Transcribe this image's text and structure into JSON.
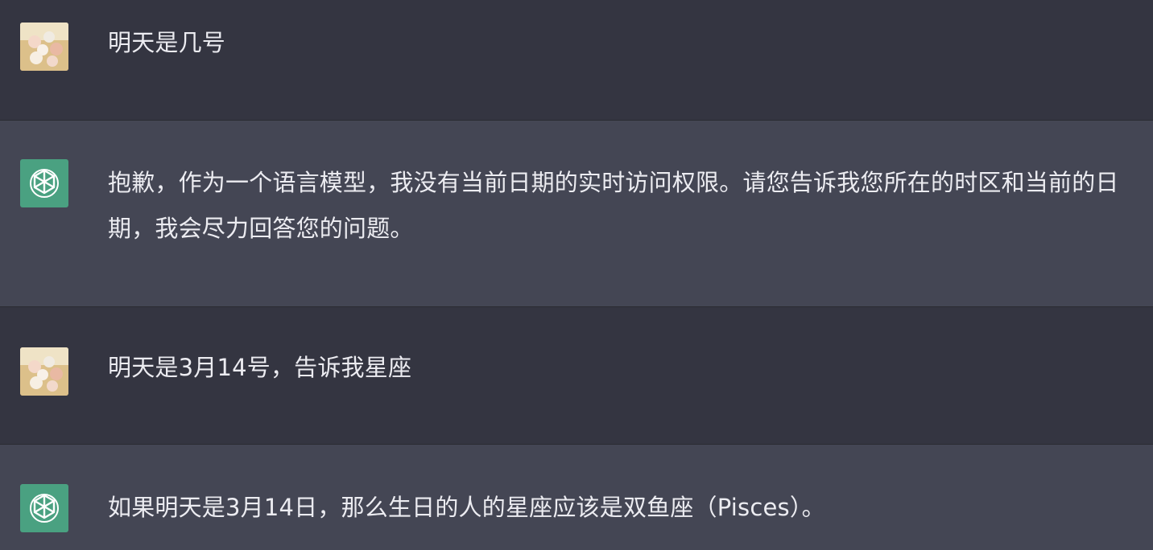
{
  "conversation": {
    "messages": [
      {
        "role": "user",
        "text": "明天是几号"
      },
      {
        "role": "assistant",
        "text": "抱歉，作为一个语言模型，我没有当前日期的实时访问权限。请您告诉我您所在的时区和当前的日期，我会尽力回答您的问题。"
      },
      {
        "role": "user",
        "text": "明天是3月14号，告诉我星座"
      },
      {
        "role": "assistant",
        "text": "如果明天是3月14日，那么生日的人的星座应该是双鱼座（Pisces）。"
      }
    ]
  },
  "icons": {
    "user_avatar": "user-avatar-food-photo",
    "assistant_avatar": "openai-logo-icon"
  },
  "colors": {
    "user_row_bg": "#343541",
    "assistant_row_bg": "#444654",
    "assistant_avatar_bg": "#4aa181",
    "text": "#ececf1"
  }
}
